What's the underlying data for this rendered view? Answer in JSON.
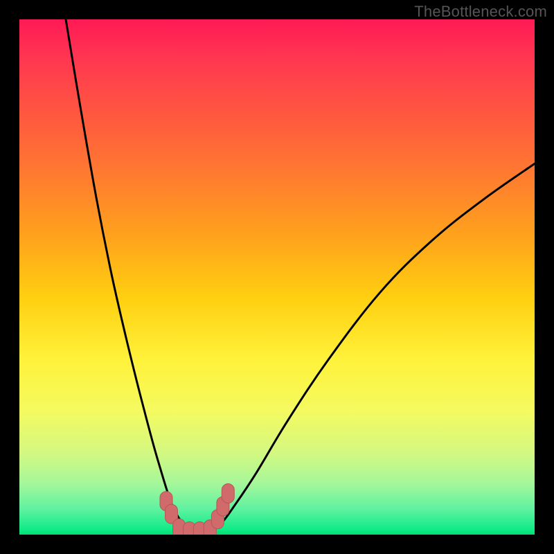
{
  "watermark": "TheBottleneck.com",
  "colors": {
    "frame": "#000000",
    "curve": "#000000",
    "marker": "#d16a6a",
    "marker_stroke": "#b85555"
  },
  "chart_data": {
    "type": "line",
    "title": "",
    "xlabel": "",
    "ylabel": "",
    "xlim": [
      0,
      100
    ],
    "ylim": [
      0,
      100
    ],
    "grid": false,
    "legend": false,
    "note": "Bottleneck V-curve. Minimum (green, ~0%) around x≈30–37. Rises steeply to ~100% at the left edge (x≈9) and more gradually toward ~72% at the right edge (x=100). Pink markers highlight the near-zero region around the trough.",
    "series": [
      {
        "name": "bottleneck-curve",
        "x": [
          9,
          12,
          15,
          18,
          21,
          24,
          27,
          30,
          33,
          36,
          39,
          42,
          46,
          52,
          60,
          70,
          80,
          90,
          100
        ],
        "y": [
          100,
          82,
          65,
          50,
          37,
          25,
          14,
          5,
          1,
          0,
          2,
          6,
          12,
          22,
          34,
          47,
          57,
          65,
          72
        ]
      }
    ],
    "markers": [
      {
        "x": 28.5,
        "y": 6.5
      },
      {
        "x": 29.5,
        "y": 4.0
      },
      {
        "x": 31.0,
        "y": 1.2
      },
      {
        "x": 33.0,
        "y": 0.6
      },
      {
        "x": 35.0,
        "y": 0.6
      },
      {
        "x": 37.0,
        "y": 1.0
      },
      {
        "x": 38.5,
        "y": 3.0
      },
      {
        "x": 39.5,
        "y": 5.5
      },
      {
        "x": 40.5,
        "y": 8.0
      }
    ]
  }
}
